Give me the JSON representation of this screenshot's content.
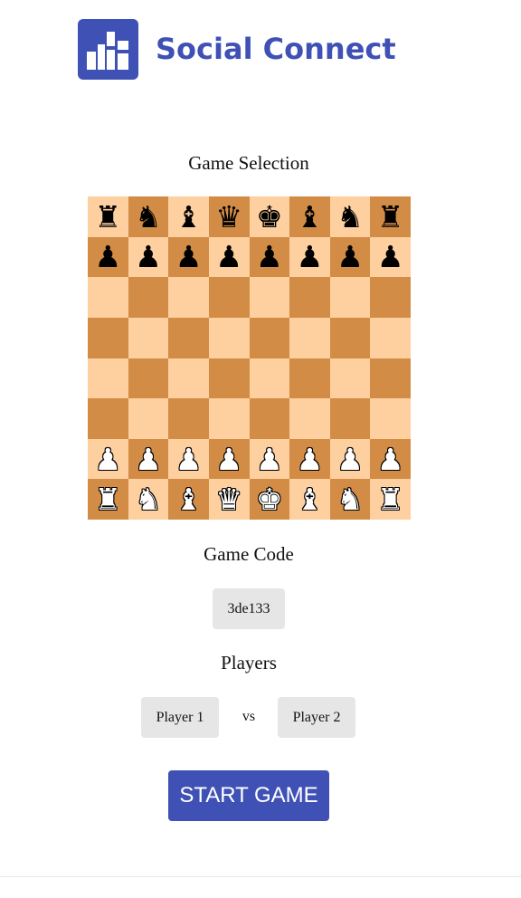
{
  "brand": {
    "name": "Social Connect",
    "color": "#3f51b5"
  },
  "game_selection": {
    "title": "Game Selection"
  },
  "board": {
    "light_color": "#fecf9f",
    "dark_color": "#d28c45",
    "rows": [
      [
        "br",
        "bn",
        "bb",
        "bq",
        "bk",
        "bb",
        "bn",
        "br"
      ],
      [
        "bp",
        "bp",
        "bp",
        "bp",
        "bp",
        "bp",
        "bp",
        "bp"
      ],
      [
        "",
        "",
        "",
        "",
        "",
        "",
        "",
        ""
      ],
      [
        "",
        "",
        "",
        "",
        "",
        "",
        "",
        ""
      ],
      [
        "",
        "",
        "",
        "",
        "",
        "",
        "",
        ""
      ],
      [
        "",
        "",
        "",
        "",
        "",
        "",
        "",
        ""
      ],
      [
        "wp",
        "wp",
        "wp",
        "wp",
        "wp",
        "wp",
        "wp",
        "wp"
      ],
      [
        "wr",
        "wn",
        "wb",
        "wq",
        "wk",
        "wb",
        "wn",
        "wr"
      ]
    ]
  },
  "game_code": {
    "title": "Game Code",
    "value": "3de133"
  },
  "players": {
    "title": "Players",
    "player1": "Player 1",
    "vs": "vs",
    "player2": "Player 2"
  },
  "start_button": {
    "label": "START GAME"
  }
}
